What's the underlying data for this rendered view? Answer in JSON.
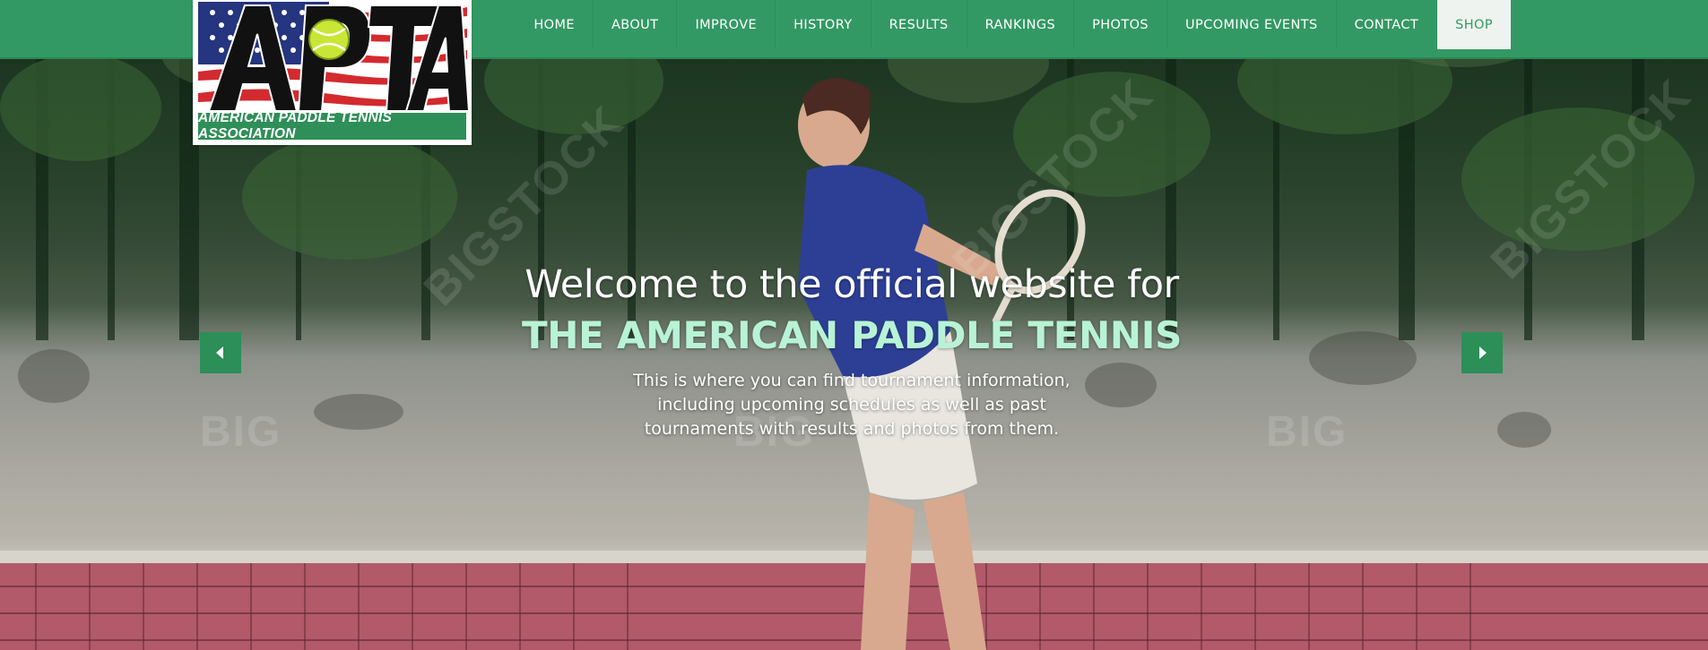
{
  "logo": {
    "letters": "APTA",
    "tagline": "AMERICAN PADDLE TENNIS ASSOCIATION"
  },
  "nav": {
    "items": [
      {
        "label": "HOME",
        "active": false
      },
      {
        "label": "ABOUT",
        "active": false
      },
      {
        "label": "IMPROVE",
        "active": false
      },
      {
        "label": "HISTORY",
        "active": false
      },
      {
        "label": "RESULTS",
        "active": false
      },
      {
        "label": "RANKINGS",
        "active": false
      },
      {
        "label": "PHOTOS",
        "active": false
      },
      {
        "label": "UPCOMING EVENTS",
        "active": false
      },
      {
        "label": "CONTACT",
        "active": false
      },
      {
        "label": "SHOP",
        "active": true
      }
    ]
  },
  "hero": {
    "headline": "Welcome to the official website for",
    "subheadline": "THE AMERICAN PADDLE TENNIS",
    "description_lines": [
      "This is where you can find tournament information,",
      "including upcoming schedules as well as past",
      "tournaments with results and photos from them."
    ],
    "watermarks": [
      "BIGSTOCK",
      "BIGSTOCK",
      "BIGSTOCK",
      "BIG",
      "BIG",
      "BIG"
    ]
  },
  "carousel": {
    "prev_icon": "caret-left-icon",
    "next_icon": "caret-right-icon"
  },
  "colors": {
    "nav_green": "#339964",
    "accent_mint": "#b8f3d6",
    "arrow_green": "#2b8f57",
    "active_bg": "#eef3ef"
  }
}
